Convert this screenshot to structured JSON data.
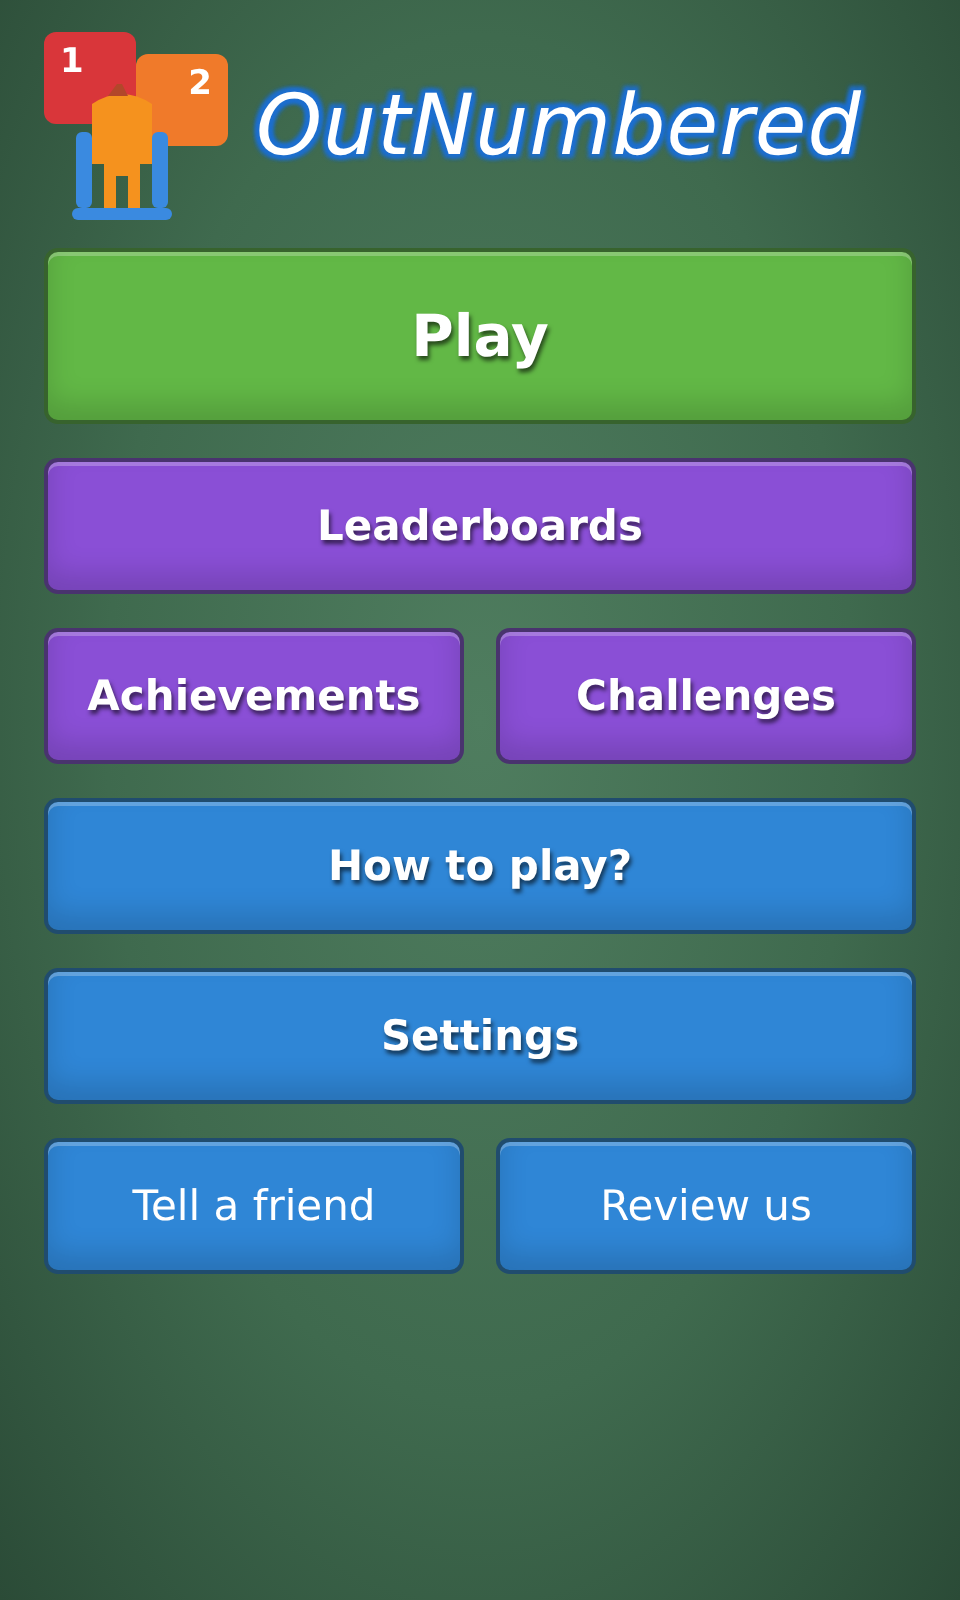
{
  "logo": {
    "title": "OutNumbered",
    "tiles": [
      {
        "label": "1",
        "color": "#d9363a"
      },
      {
        "label": "2",
        "color": "#f07a2a"
      }
    ]
  },
  "menu": [
    {
      "items": [
        {
          "label": "Play",
          "color": "#62b846",
          "bold": true,
          "kind": "primary"
        }
      ]
    },
    {
      "items": [
        {
          "label": "Leaderboards",
          "color": "#8a4fd6",
          "bold": true,
          "kind": "standard"
        }
      ]
    },
    {
      "items": [
        {
          "label": "Achievements",
          "color": "#8a4fd6",
          "bold": true,
          "kind": "standard"
        },
        {
          "label": "Challenges",
          "color": "#8a4fd6",
          "bold": true,
          "kind": "standard"
        }
      ]
    },
    {
      "items": [
        {
          "label": "How to play?",
          "color": "#2f86d6",
          "bold": true,
          "kind": "standard"
        }
      ]
    },
    {
      "items": [
        {
          "label": "Settings",
          "color": "#2f86d6",
          "bold": true,
          "kind": "standard"
        }
      ]
    },
    {
      "items": [
        {
          "label": "Tell a friend",
          "color": "#2f86d6",
          "bold": false,
          "kind": "standard"
        },
        {
          "label": "Review us",
          "color": "#2f86d6",
          "bold": false,
          "kind": "standard"
        }
      ]
    }
  ]
}
